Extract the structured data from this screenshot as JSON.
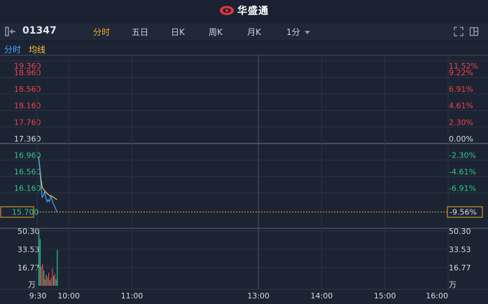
{
  "app": {
    "brand": "华盛通"
  },
  "toolbar": {
    "code": "01347",
    "tabs": [
      "分时",
      "五日",
      "日K",
      "周K",
      "月K"
    ],
    "active_tab": 0,
    "period": "1分"
  },
  "legend": {
    "intraday_label": "分时",
    "avg_label": "均线"
  },
  "colors": {
    "up": "#f0414c",
    "down": "#2ec58a",
    "flat": "#d6dbe3",
    "price_line": "#4aa3ff",
    "avg_line": "#f5c531",
    "accent": "#f5a623"
  },
  "chart_data": {
    "type": "line",
    "price_ticks": [
      "19.360",
      "18.960",
      "18.560",
      "18.160",
      "17.760",
      "17.360",
      "16.960",
      "16.560",
      "16.160"
    ],
    "pct_ticks": [
      "11.52%",
      "9.22%",
      "6.91%",
      "4.61%",
      "2.30%",
      "0.00%",
      "-2.30%",
      "-4.61%",
      "-6.91%"
    ],
    "prev_close": 17.36,
    "ylim": [
      15.66,
      19.36
    ],
    "current_price": "15.700",
    "current_pct": "-9.56%",
    "x_ticks": [
      "9:30",
      "10:00",
      "11:00",
      "13:00",
      "14:00",
      "15:00",
      "16:00"
    ],
    "price": [
      17.05,
      16.75,
      16.35,
      16.05,
      16.1,
      16.2,
      16.05,
      15.95,
      16.0,
      15.95,
      16.1,
      16.0,
      15.9,
      15.85,
      15.78,
      15.7
    ],
    "avg": [
      17.05,
      16.8,
      16.5,
      16.3,
      16.25,
      16.22,
      16.18,
      16.15,
      16.12,
      16.1,
      16.1,
      16.08,
      16.06,
      16.04,
      16.02,
      16.0
    ],
    "volume_ticks": [
      "50.30",
      "33.53",
      "16.77"
    ],
    "volume_unit": "万",
    "volume_max": 50.3,
    "volume": [
      50.3,
      43,
      18,
      20,
      14,
      6,
      10,
      8,
      12,
      5,
      7,
      16,
      9,
      11,
      6,
      33
    ],
    "volume_dir": [
      "down",
      "down",
      "up",
      "up",
      "down",
      "up",
      "down",
      "up",
      "up",
      "down",
      "up",
      "up",
      "down",
      "up",
      "down",
      "down"
    ]
  }
}
